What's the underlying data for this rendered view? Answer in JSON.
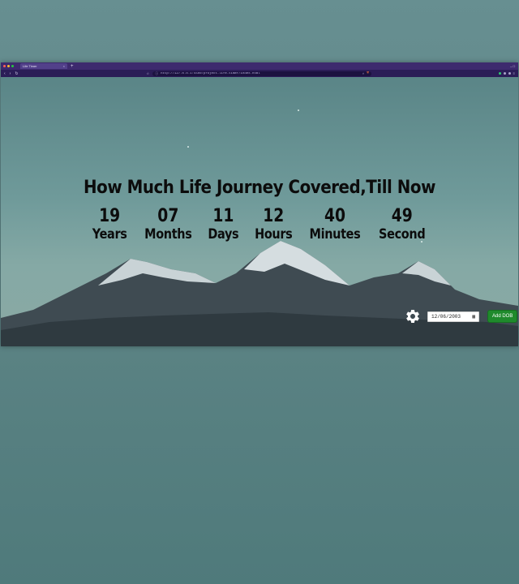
{
  "browser": {
    "tab_title": "Life Timer",
    "tab_close": "×",
    "new_tab": "+",
    "window_controls": "–  □",
    "nav": {
      "back": "‹",
      "forward": "›",
      "reload": "↻"
    },
    "bookmark_icon": "☆",
    "url": "http://127.0.0.1:5500/project-life-timer/index.html"
  },
  "page": {
    "heading": "How Much Life Journey Covered,Till Now",
    "counters": [
      {
        "value": "19",
        "label": "Years"
      },
      {
        "value": "07",
        "label": "Months"
      },
      {
        "value": "11",
        "label": "Days"
      },
      {
        "value": "12",
        "label": "Hours"
      },
      {
        "value": "40",
        "label": "Minutes"
      },
      {
        "value": "49",
        "label": "Second"
      }
    ],
    "settings_icon": "gear-icon",
    "dob_input": {
      "value": "12/06/2003"
    },
    "add_dob_label": "Add DOB"
  },
  "colors": {
    "tab_bar": "#3d2a6e",
    "toolbar": "#2b1d57",
    "add_button": "#1f8a2c",
    "text": "#0c0c0c"
  }
}
